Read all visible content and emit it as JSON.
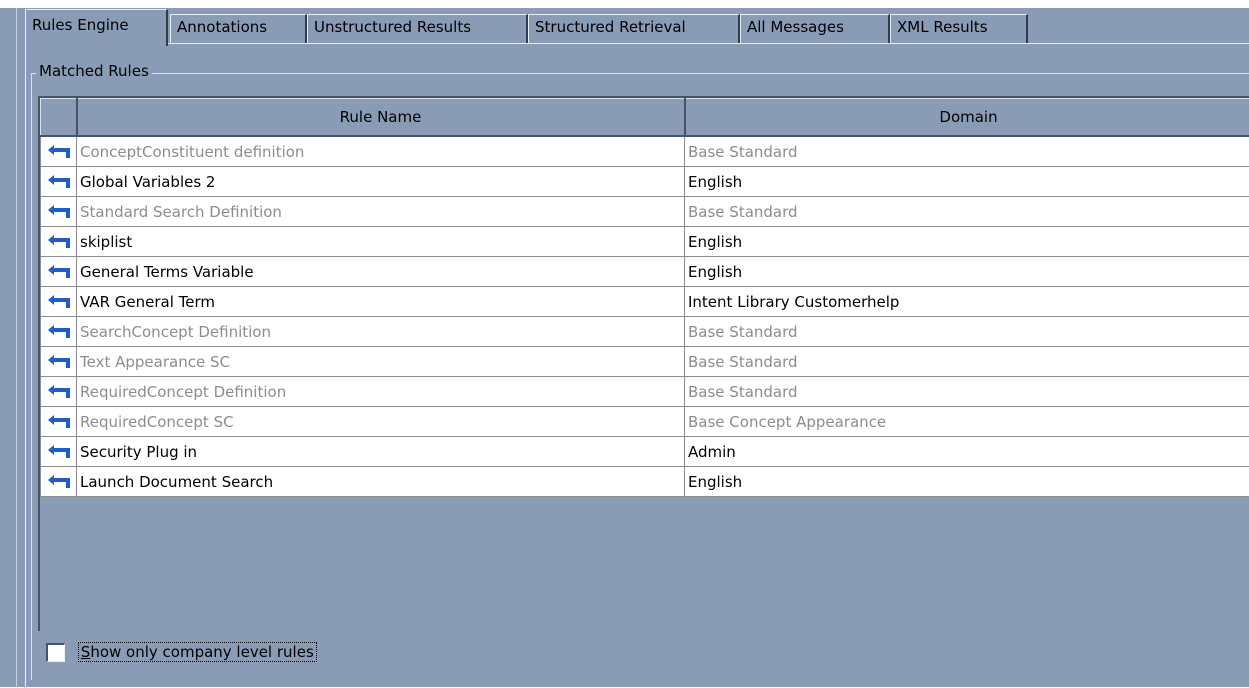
{
  "tabs": [
    {
      "label": "Rules Engine",
      "active": true
    },
    {
      "label": "Annotations",
      "active": false
    },
    {
      "label": "Unstructured Results",
      "active": false
    },
    {
      "label": "Structured Retrieval",
      "active": false
    },
    {
      "label": "All Messages",
      "active": false
    },
    {
      "label": "XML Results",
      "active": false
    }
  ],
  "group": {
    "title": "Matched Rules"
  },
  "table": {
    "columns": [
      "",
      "Rule Name",
      "Domain"
    ],
    "rows": [
      {
        "rule": "ConceptConstituent definition",
        "domain": "Base Standard",
        "dim": true
      },
      {
        "rule": "Global Variables 2",
        "domain": "English",
        "dim": false
      },
      {
        "rule": "Standard Search Definition",
        "domain": "Base Standard",
        "dim": true
      },
      {
        "rule": "skiplist",
        "domain": "English",
        "dim": false
      },
      {
        "rule": "General Terms Variable",
        "domain": "English",
        "dim": false
      },
      {
        "rule": "VAR General Term",
        "domain": "Intent Library Customerhelp",
        "dim": false
      },
      {
        "rule": "SearchConcept Definition",
        "domain": "Base Standard",
        "dim": true
      },
      {
        "rule": "Text Appearance SC",
        "domain": "Base Standard",
        "dim": true
      },
      {
        "rule": "RequiredConcept Definition",
        "domain": "Base Standard",
        "dim": true
      },
      {
        "rule": "RequiredConcept SC",
        "domain": "Base Concept Appearance",
        "dim": true
      },
      {
        "rule": "Security Plug in",
        "domain": "Admin",
        "dim": false
      },
      {
        "rule": "Launch Document Search",
        "domain": "English",
        "dim": false
      }
    ]
  },
  "checkbox": {
    "label_first": "S",
    "label_rest": "how only company level rules",
    "checked": false
  },
  "icons": {
    "row_icon": "return-arrow-icon"
  },
  "colors": {
    "panel": "#8a9cb5",
    "arrow": "#1f5cc8",
    "dim_text": "#8c8c8c"
  }
}
